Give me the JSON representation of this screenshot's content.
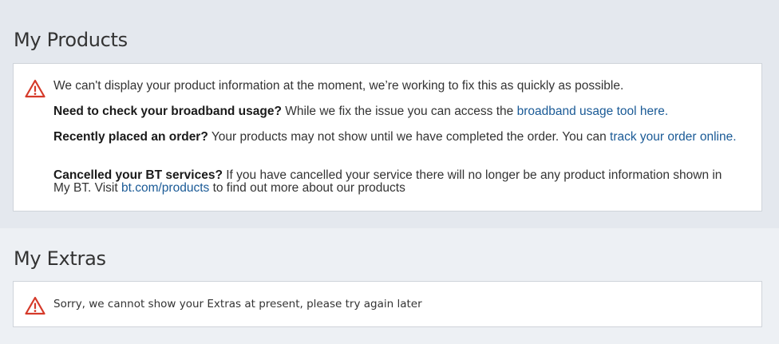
{
  "products": {
    "title": "My Products",
    "intro": "We can't display your product information at the moment, we’re working to fix this as quickly as possible.",
    "broadband": {
      "heading": "Need to check your broadband usage?",
      "text": " While we fix the issue you can access the ",
      "link": "broadband usage tool here."
    },
    "order": {
      "heading": "Recently placed an order?",
      "text": " Your products may not show until we have completed the order. You can ",
      "link": "track your order online."
    },
    "cancelled": {
      "heading": "Cancelled your BT services?",
      "text": " If you have cancelled your service there will no longer be any product information shown in My BT. Visit ",
      "link": "bt.com/products",
      "text_after": " to find out more about our products"
    }
  },
  "extras": {
    "title": "My Extras",
    "message": "Sorry, we cannot show your Extras at present, please try again later"
  },
  "icons": {
    "warning": "warning-triangle-icon"
  },
  "colors": {
    "warning": "#d53a2a",
    "link": "#1a5a96"
  }
}
